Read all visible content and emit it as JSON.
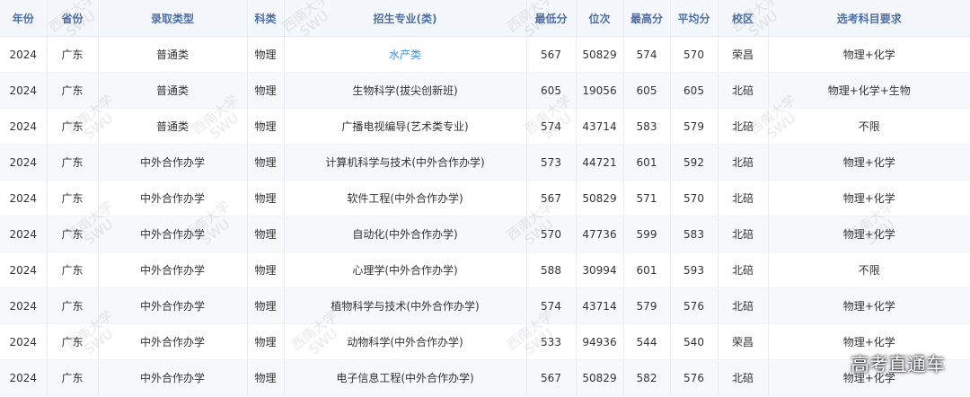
{
  "table": {
    "headers": [
      "年份",
      "省份",
      "录取类型",
      "科类",
      "招生专业(类)",
      "最低分",
      "位次",
      "最高分",
      "平均分",
      "校区",
      "选考科目要求"
    ],
    "rows": [
      [
        "2024",
        "广东",
        "普通类",
        "物理",
        "水产类",
        "567",
        "50829",
        "574",
        "570",
        "荣昌",
        "物理+化学"
      ],
      [
        "2024",
        "广东",
        "普通类",
        "物理",
        "生物科学(拔尖创新班)",
        "605",
        "19056",
        "605",
        "605",
        "北碚",
        "物理+化学+生物"
      ],
      [
        "2024",
        "广东",
        "普通类",
        "物理",
        "广播电视编导(艺术类专业)",
        "574",
        "43714",
        "583",
        "579",
        "北碚",
        "不限"
      ],
      [
        "2024",
        "广东",
        "中外合作办学",
        "物理",
        "计算机科学与技术(中外合作办学)",
        "573",
        "44721",
        "601",
        "592",
        "北碚",
        "物理+化学"
      ],
      [
        "2024",
        "广东",
        "中外合作办学",
        "物理",
        "软件工程(中外合作办学)",
        "567",
        "50829",
        "571",
        "570",
        "北碚",
        "物理+化学"
      ],
      [
        "2024",
        "广东",
        "中外合作办学",
        "物理",
        "自动化(中外合作办学)",
        "570",
        "47736",
        "599",
        "583",
        "北碚",
        "物理+化学"
      ],
      [
        "2024",
        "广东",
        "中外合作办学",
        "物理",
        "心理学(中外合作办学)",
        "588",
        "30994",
        "601",
        "593",
        "北碚",
        "不限"
      ],
      [
        "2024",
        "广东",
        "中外合作办学",
        "物理",
        "植物科学与技术(中外合作办学)",
        "574",
        "43714",
        "579",
        "576",
        "北碚",
        "物理+化学"
      ],
      [
        "2024",
        "广东",
        "中外合作办学",
        "物理",
        "动物科学(中外合作办学)",
        "533",
        "94936",
        "544",
        "540",
        "荣昌",
        "物理+化学"
      ],
      [
        "2024",
        "广东",
        "中外合作办学",
        "物理",
        "电子信息工程(中外合作办学)",
        "567",
        "50829",
        "582",
        "576",
        "北碚",
        "物理+化学"
      ]
    ]
  },
  "watermark": {
    "line1": "西南大学",
    "line2": "SWU"
  },
  "brand": "高考直通车",
  "colors": {
    "header_bg": "#f4f7fb",
    "header_text": "#4d6fa8",
    "link": "#3a8ee6",
    "stripe": "#f7f8fa"
  }
}
